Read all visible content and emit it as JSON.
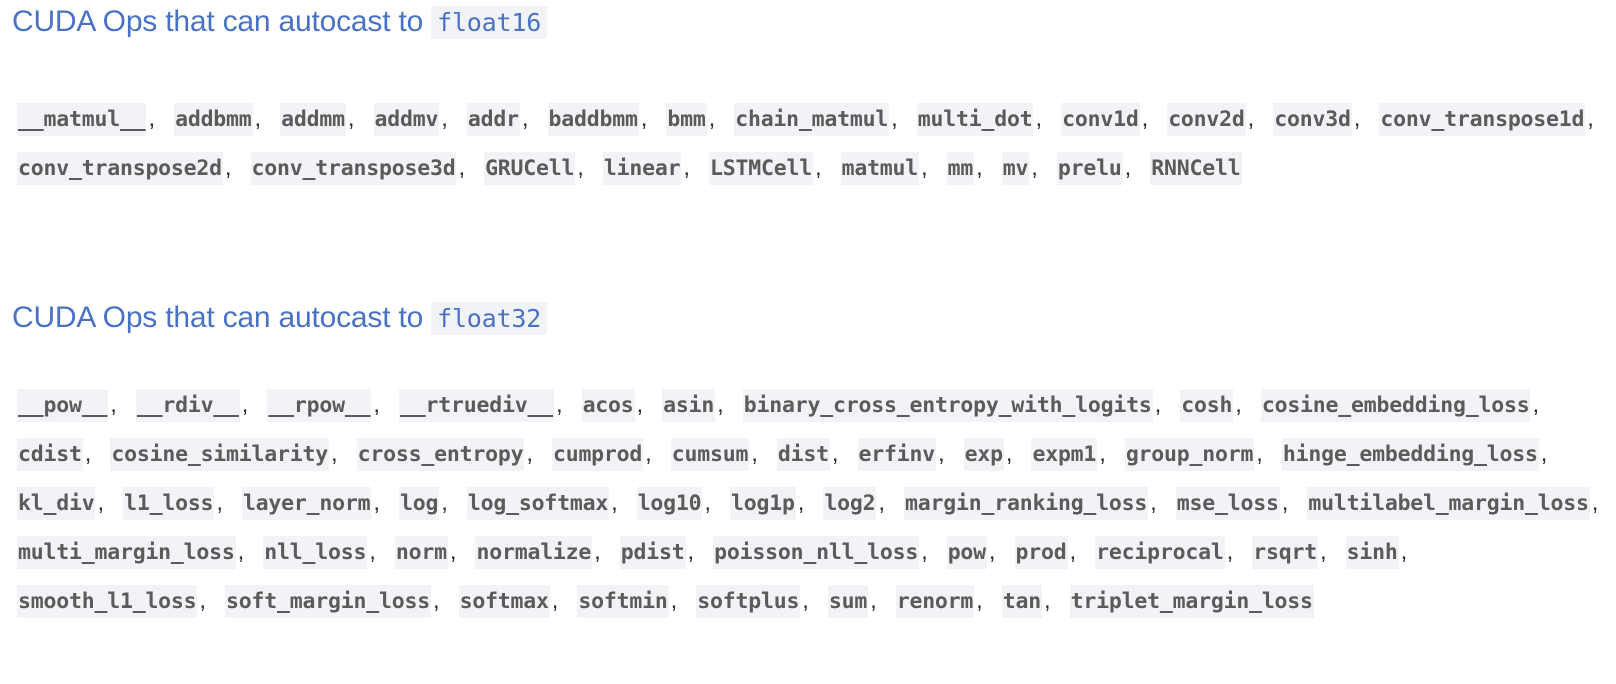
{
  "sections": [
    {
      "id": "fp16",
      "heading_text": "CUDA Ops that can autocast to",
      "heading_code": "float16",
      "ops": [
        "__matmul__",
        "addbmm",
        "addmm",
        "addmv",
        "addr",
        "baddbmm",
        "bmm",
        "chain_matmul",
        "multi_dot",
        "conv1d",
        "conv2d",
        "conv3d",
        "conv_transpose1d",
        "conv_transpose2d",
        "conv_transpose3d",
        "GRUCell",
        "linear",
        "LSTMCell",
        "matmul",
        "mm",
        "mv",
        "prelu",
        "RNNCell"
      ]
    },
    {
      "id": "fp32",
      "heading_text": "CUDA Ops that can autocast to",
      "heading_code": "float32",
      "ops": [
        "__pow__",
        "__rdiv__",
        "__rpow__",
        "__rtruediv__",
        "acos",
        "asin",
        "binary_cross_entropy_with_logits",
        "cosh",
        "cosine_embedding_loss",
        "cdist",
        "cosine_similarity",
        "cross_entropy",
        "cumprod",
        "cumsum",
        "dist",
        "erfinv",
        "exp",
        "expm1",
        "group_norm",
        "hinge_embedding_loss",
        "kl_div",
        "l1_loss",
        "layer_norm",
        "log",
        "log_softmax",
        "log10",
        "log1p",
        "log2",
        "margin_ranking_loss",
        "mse_loss",
        "multilabel_margin_loss",
        "multi_margin_loss",
        "nll_loss",
        "norm",
        "normalize",
        "pdist",
        "poisson_nll_loss",
        "pow",
        "prod",
        "reciprocal",
        "rsqrt",
        "sinh",
        "smooth_l1_loss",
        "soft_margin_loss",
        "softmax",
        "softmin",
        "softplus",
        "sum",
        "renorm",
        "tan",
        "triplet_margin_loss"
      ]
    }
  ],
  "separator": ",",
  "colors": {
    "heading": "#4a72c4",
    "code_background": "#f2f3f6",
    "code_text": "#5b5b5b"
  }
}
